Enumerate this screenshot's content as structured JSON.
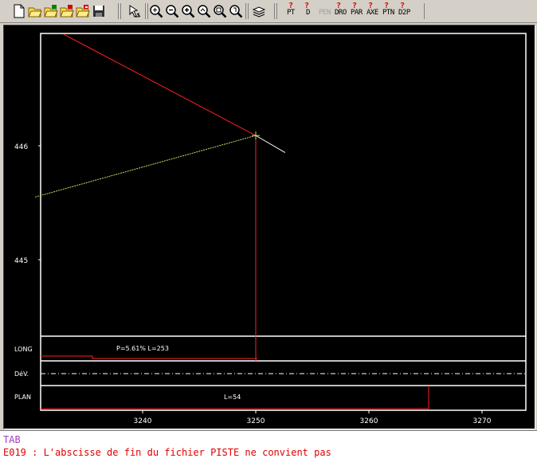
{
  "toolbar": {
    "icons": [
      "new-file-icon",
      "open-folder-icon",
      "open-folder-2-icon",
      "open-folder-3-icon",
      "open-folder-4-icon",
      "save-icon",
      "pointer-tool-icon",
      "zoom-fit-icon",
      "zoom-out-icon",
      "zoom-in-icon",
      "zoom-previous-icon",
      "zoom-window-icon",
      "zoom-all-icon",
      "layers-icon"
    ],
    "text_buttons": [
      {
        "label": "PT",
        "has_q": true,
        "enabled": true
      },
      {
        "label": "D",
        "has_q": true,
        "enabled": true
      },
      {
        "label": "PEN",
        "has_q": false,
        "enabled": false
      },
      {
        "label": "DRO",
        "has_q": true,
        "enabled": true
      },
      {
        "label": "PAR",
        "has_q": true,
        "enabled": true
      },
      {
        "label": "AXE",
        "has_q": true,
        "enabled": true
      },
      {
        "label": "PTN",
        "has_q": true,
        "enabled": true
      },
      {
        "label": "D2P",
        "has_q": true,
        "enabled": true
      }
    ]
  },
  "plot": {
    "y_ticks": [
      "446",
      "445"
    ],
    "x_ticks": [
      "3240",
      "3250",
      "3260",
      "3270"
    ],
    "band_labels": {
      "long": "LONG",
      "dev": "DéV.",
      "plan": "PLAN"
    },
    "long_annotation": "P=5.61% L=253",
    "plan_annotation": "L=54",
    "colors": {
      "background": "#000000",
      "frame": "#ffffff",
      "profile": "#ff2020",
      "grade_line": "#ffffff",
      "terrain": "#c8e060"
    }
  },
  "chart_data": {
    "type": "line",
    "x_range": [
      3230.5,
      3273.5
    ],
    "y_range": [
      444,
      446.9
    ],
    "x_ticks": [
      3240,
      3250,
      3260,
      3270
    ],
    "y_ticks": [
      445,
      446
    ],
    "series": [
      {
        "values": [
          [
            3233,
            446.98
          ],
          [
            3250,
            446.09
          ]
        ]
      },
      {
        "values": [
          [
            3250,
            446.09
          ],
          [
            3252.6,
            445.94
          ]
        ]
      },
      {
        "values": [
          [
            3230.5,
            445.55
          ],
          [
            3250,
            446.09
          ]
        ]
      }
    ],
    "vertical_marker_x": 3250,
    "plan_marker_x": 3265.2
  },
  "messages": {
    "tab": "TAB",
    "error": "E019 : L'abscisse de fin du fichier PISTE ne convient pas"
  }
}
